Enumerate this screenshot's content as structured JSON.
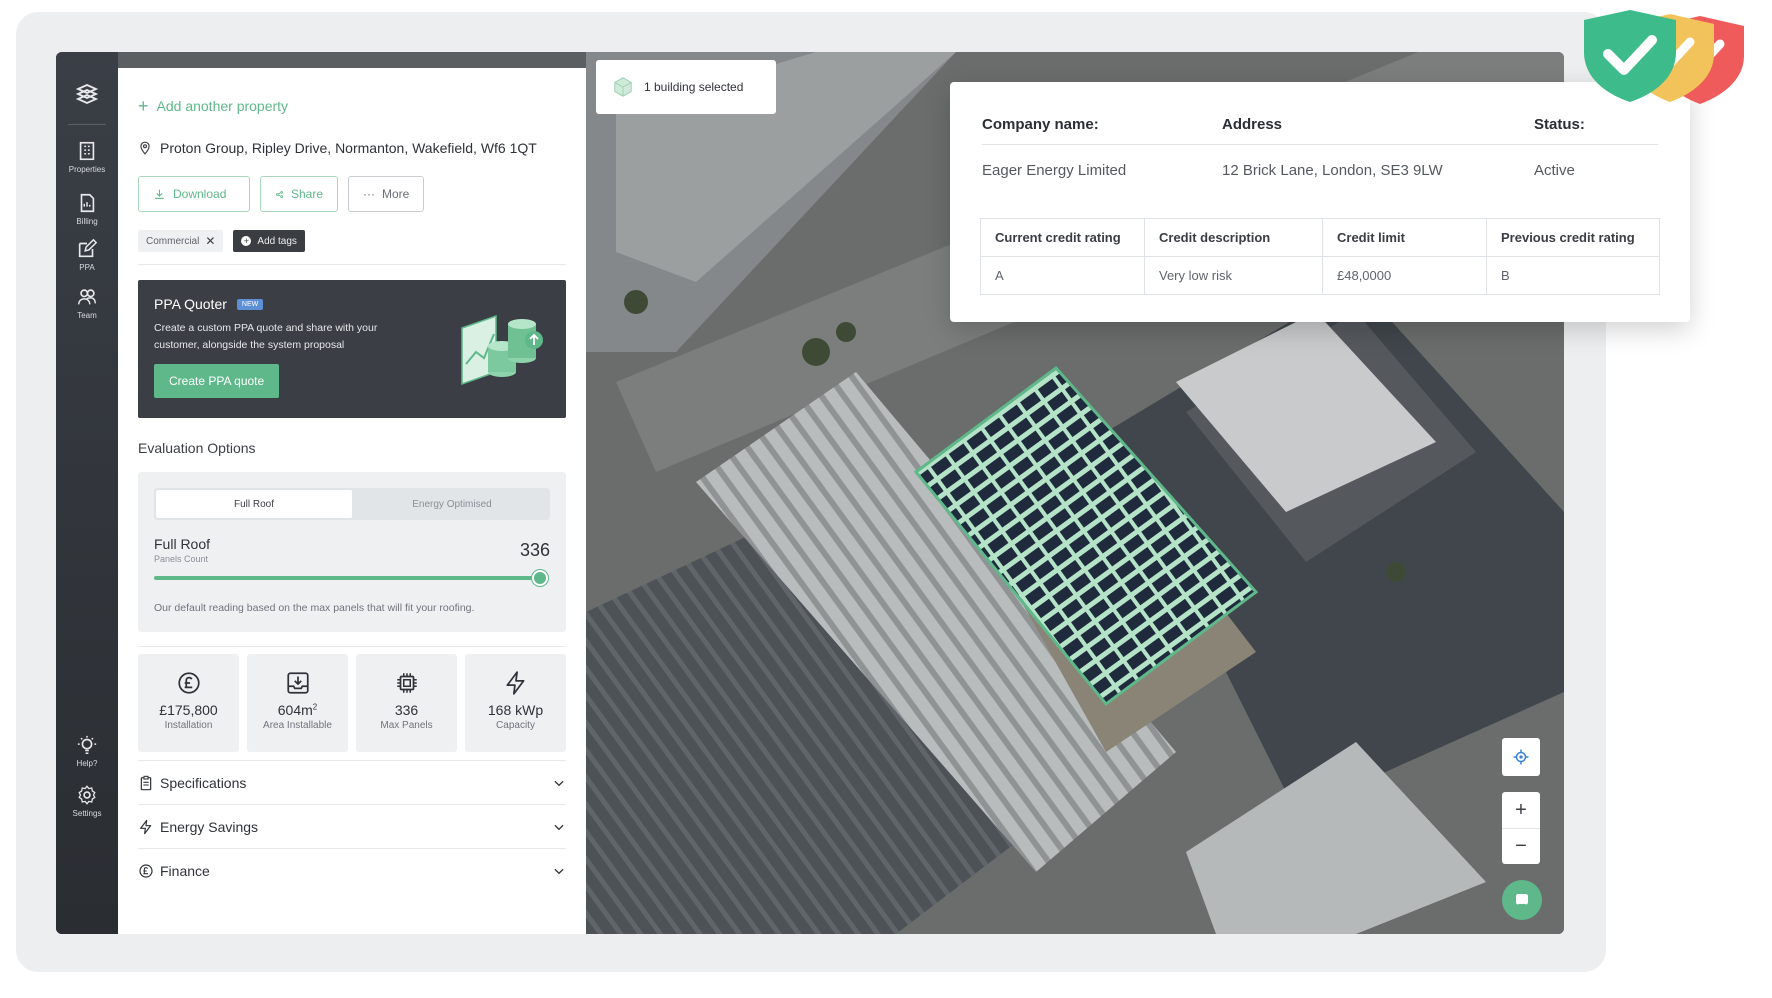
{
  "sidebar_rail": {
    "logo_icon": "stacked-layers-logo",
    "items": [
      {
        "label": "Properties",
        "icon": "building-icon"
      },
      {
        "label": "Billing",
        "icon": "bill-icon"
      },
      {
        "label": "PPA",
        "icon": "edit-icon"
      },
      {
        "label": "Team",
        "icon": "team-icon"
      },
      {
        "label": "Help?",
        "icon": "lightbulb-icon"
      },
      {
        "label": "Settings",
        "icon": "gear-icon"
      }
    ]
  },
  "panel": {
    "add_property": "Add another property",
    "address": "Proton Group, Ripley Drive, Normanton, Wakefield, Wf6 1QT",
    "actions": {
      "download": "Download",
      "share": "Share",
      "more": "More"
    },
    "tags": {
      "commercial": "Commercial",
      "add_tags": "Add tags"
    },
    "ppa_quoter": {
      "title": "PPA Quoter",
      "badge": "NEW",
      "description": "Create a custom PPA quote and share with your customer, alongside the system proposal",
      "button": "Create PPA quote"
    },
    "evaluation": {
      "title": "Evaluation Options",
      "tabs": [
        "Full Roof",
        "Energy Optimised"
      ],
      "active_tab": "Full Roof",
      "label": "Full Roof",
      "sublabel": "Panels Count",
      "value": "336",
      "slider_fraction": 1.0,
      "note": "Our default reading based on the max panels that will fit your roofing."
    },
    "stats": [
      {
        "value": "£175,800",
        "label": "Installation",
        "icon": "pound-icon"
      },
      {
        "value": "604m",
        "sup": "2",
        "label": "Area Installable",
        "icon": "tray-download-icon"
      },
      {
        "value": "336",
        "label": "Max Panels",
        "icon": "chip-icon"
      },
      {
        "value": "168 kWp",
        "label": "Capacity",
        "icon": "bolt-icon"
      }
    ],
    "accordions": [
      {
        "label": "Specifications",
        "icon": "clipboard-icon"
      },
      {
        "label": "Energy Savings",
        "icon": "bolt-icon"
      },
      {
        "label": "Finance",
        "icon": "pound-icon"
      }
    ]
  },
  "map": {
    "selection_chip": "1 building selected",
    "company_card": {
      "headers": {
        "company": "Company name:",
        "address": "Address",
        "status": "Status:"
      },
      "values": {
        "company": "Eager Energy Limited",
        "address": "12 Brick Lane, London, SE3 9LW",
        "status": "Active"
      },
      "table": {
        "columns": [
          "Current credit rating",
          "Credit description",
          "Credit limit",
          "Previous credit rating"
        ],
        "row": [
          "A",
          "Very low risk",
          "£48,0000",
          "B"
        ]
      }
    },
    "controls": {
      "zoom_in": "+",
      "zoom_out": "−"
    }
  },
  "colors": {
    "accent": "#5fb88a",
    "rail": "#2f3338",
    "shield_green": "#3dbb8a",
    "shield_yellow": "#f2c35a",
    "shield_red": "#ef5a5a"
  }
}
